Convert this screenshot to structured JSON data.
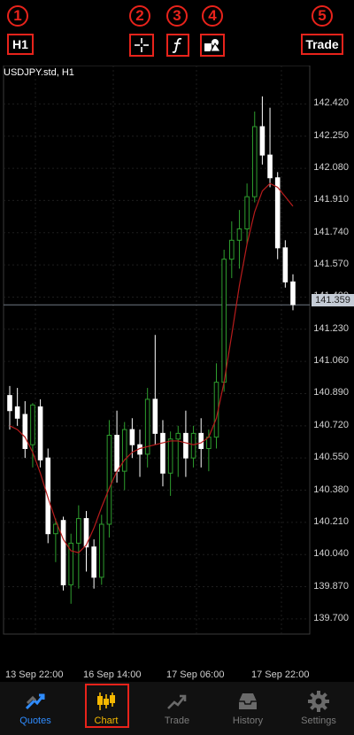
{
  "toolbar": {
    "timeframe_label": "H1",
    "trade_label": "Trade",
    "marker_1": "1",
    "marker_2": "2",
    "marker_3": "3",
    "marker_4": "4",
    "marker_5": "5",
    "crosshair_icon": "crosshair-icon",
    "indicators_icon": "function-icon",
    "objects_icon": "shapes-icon"
  },
  "chart": {
    "symbol_label": "USDJPY.std, H1",
    "current_price_label": "141.359",
    "y_axis_labels": [
      "142.420",
      "142.250",
      "142.080",
      "141.910",
      "141.740",
      "141.570",
      "141.400",
      "141.230",
      "141.060",
      "140.890",
      "140.720",
      "140.550",
      "140.380",
      "140.210",
      "140.040",
      "139.870",
      "139.700"
    ],
    "x_axis_labels": [
      "13 Sep 22:00",
      "16 Sep 14:00",
      "17 Sep 06:00",
      "17 Sep 22:00"
    ],
    "colors": {
      "bull": "#2e9e2e",
      "bear": "#ffffff",
      "ma": "#b81c1c",
      "grid": "#1e1e1e"
    }
  },
  "chart_data": {
    "type": "candlestick",
    "title": "USDJPY.std, H1",
    "ylim": [
      139.62,
      142.52
    ],
    "current_price": 141.359,
    "moving_average": [
      140.72,
      140.7,
      140.66,
      140.58,
      140.47,
      140.34,
      140.22,
      140.12,
      140.06,
      140.05,
      140.09,
      140.18,
      140.29,
      140.39,
      140.48,
      140.54,
      140.58,
      140.6,
      140.61,
      140.62,
      140.63,
      140.64,
      140.64,
      140.63,
      140.62,
      140.63,
      140.66,
      140.76,
      140.95,
      141.2,
      141.46,
      141.68,
      141.85,
      141.96,
      142.0,
      141.98,
      141.93,
      141.88
    ],
    "candles": [
      {
        "o": 140.88,
        "h": 140.93,
        "l": 140.7,
        "c": 140.8
      },
      {
        "o": 140.82,
        "h": 140.92,
        "l": 140.72,
        "c": 140.76
      },
      {
        "o": 140.78,
        "h": 140.85,
        "l": 140.55,
        "c": 140.6
      },
      {
        "o": 140.62,
        "h": 140.84,
        "l": 140.5,
        "c": 140.83
      },
      {
        "o": 140.82,
        "h": 140.86,
        "l": 140.5,
        "c": 140.54
      },
      {
        "o": 140.55,
        "h": 140.6,
        "l": 140.1,
        "c": 140.15
      },
      {
        "o": 140.15,
        "h": 140.23,
        "l": 140.0,
        "c": 140.2
      },
      {
        "o": 140.22,
        "h": 140.24,
        "l": 139.85,
        "c": 139.88
      },
      {
        "o": 139.88,
        "h": 140.15,
        "l": 139.78,
        "c": 140.1
      },
      {
        "o": 140.1,
        "h": 140.3,
        "l": 139.86,
        "c": 140.23
      },
      {
        "o": 140.23,
        "h": 140.27,
        "l": 139.95,
        "c": 140.08
      },
      {
        "o": 140.08,
        "h": 140.12,
        "l": 139.86,
        "c": 139.92
      },
      {
        "o": 139.92,
        "h": 140.25,
        "l": 139.88,
        "c": 140.2
      },
      {
        "o": 140.2,
        "h": 140.75,
        "l": 140.13,
        "c": 140.67
      },
      {
        "o": 140.67,
        "h": 140.8,
        "l": 140.42,
        "c": 140.48
      },
      {
        "o": 140.48,
        "h": 140.74,
        "l": 140.38,
        "c": 140.7
      },
      {
        "o": 140.7,
        "h": 140.76,
        "l": 140.55,
        "c": 140.62
      },
      {
        "o": 140.62,
        "h": 140.7,
        "l": 140.45,
        "c": 140.57
      },
      {
        "o": 140.57,
        "h": 140.92,
        "l": 140.5,
        "c": 140.86
      },
      {
        "o": 140.86,
        "h": 141.2,
        "l": 140.62,
        "c": 140.68
      },
      {
        "o": 140.68,
        "h": 140.75,
        "l": 140.4,
        "c": 140.47
      },
      {
        "o": 140.47,
        "h": 140.69,
        "l": 140.35,
        "c": 140.65
      },
      {
        "o": 140.65,
        "h": 140.72,
        "l": 140.45,
        "c": 140.68
      },
      {
        "o": 140.68,
        "h": 140.8,
        "l": 140.45,
        "c": 140.55
      },
      {
        "o": 140.55,
        "h": 140.72,
        "l": 140.5,
        "c": 140.68
      },
      {
        "o": 140.68,
        "h": 140.76,
        "l": 140.5,
        "c": 140.6
      },
      {
        "o": 140.6,
        "h": 140.7,
        "l": 140.48,
        "c": 140.66
      },
      {
        "o": 140.66,
        "h": 141.05,
        "l": 140.6,
        "c": 140.95
      },
      {
        "o": 140.95,
        "h": 141.65,
        "l": 140.9,
        "c": 141.6
      },
      {
        "o": 141.6,
        "h": 141.8,
        "l": 141.5,
        "c": 141.7
      },
      {
        "o": 141.7,
        "h": 141.86,
        "l": 141.55,
        "c": 141.76
      },
      {
        "o": 141.76,
        "h": 142.0,
        "l": 141.68,
        "c": 141.93
      },
      {
        "o": 141.93,
        "h": 142.38,
        "l": 141.9,
        "c": 142.3
      },
      {
        "o": 142.3,
        "h": 142.46,
        "l": 142.1,
        "c": 142.15
      },
      {
        "o": 142.15,
        "h": 142.4,
        "l": 141.98,
        "c": 142.03
      },
      {
        "o": 142.03,
        "h": 142.06,
        "l": 141.6,
        "c": 141.66
      },
      {
        "o": 141.66,
        "h": 141.7,
        "l": 141.45,
        "c": 141.48
      },
      {
        "o": 141.48,
        "h": 141.52,
        "l": 141.33,
        "c": 141.36
      }
    ]
  },
  "tabbar": {
    "items": [
      {
        "label": "Quotes",
        "icon": "quotes-icon"
      },
      {
        "label": "Chart",
        "icon": "candlestick-icon"
      },
      {
        "label": "Trade",
        "icon": "trade-icon"
      },
      {
        "label": "History",
        "icon": "inbox-icon"
      },
      {
        "label": "Settings",
        "icon": "gear-icon"
      }
    ]
  }
}
